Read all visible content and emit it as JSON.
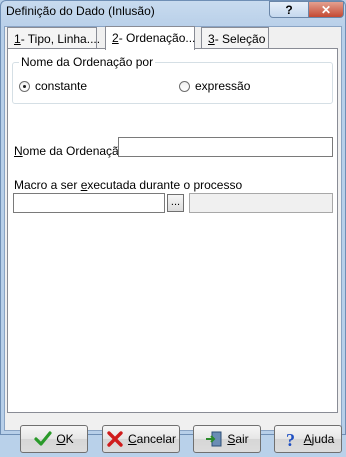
{
  "window": {
    "title": "Definição do Dado (Inlusão)",
    "help_symbol": "?",
    "close_symbol": "✕"
  },
  "tabs": [
    {
      "key": "1",
      "rest": "- Tipo, Linha....",
      "active": false
    },
    {
      "key": "2",
      "rest": "- Ordenação...",
      "active": true
    },
    {
      "key": "3",
      "rest": "- Seleção",
      "active": false
    }
  ],
  "ordering": {
    "group_label": "Nome da Ordenação por",
    "option_constant": "constante",
    "option_expression": "expressão",
    "selected": "constante"
  },
  "name_field": {
    "label_underlined": "N",
    "label_rest": "ome da Ordenação",
    "value": ""
  },
  "macro": {
    "label_pre": "Macro a ser ",
    "label_underlined": "e",
    "label_rest": "xecutada durante o processo",
    "value": "",
    "browse_label": "...",
    "display_value": ""
  },
  "buttons": {
    "ok_u": "O",
    "ok_rest": "K",
    "cancel_u": "C",
    "cancel_rest": "ancelar",
    "exit_u": "S",
    "exit_rest": "air",
    "help_u": "A",
    "help_rest": "juda"
  },
  "icons": {
    "ok": "check-icon",
    "cancel": "x-icon",
    "exit": "exit-door-icon",
    "help": "question-icon"
  }
}
